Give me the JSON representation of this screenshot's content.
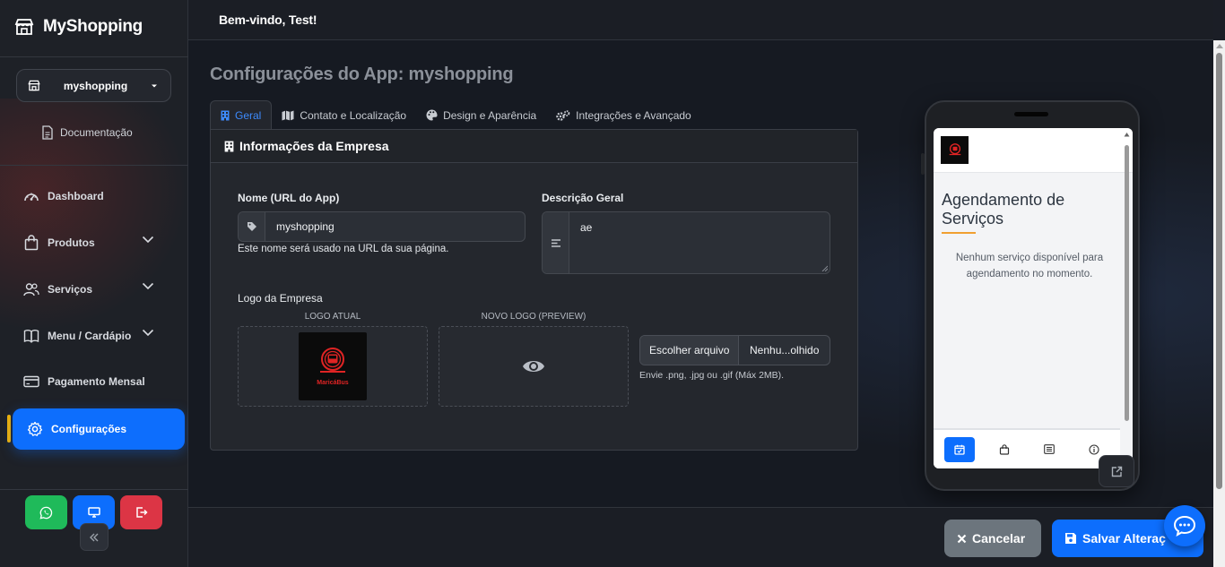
{
  "app": {
    "brand": "MyShopping"
  },
  "sidebar": {
    "store_selector": "myshopping",
    "doc_link": "Documentação",
    "items": [
      {
        "label": "Dashboard",
        "icon": "dashboard-gauge-icon",
        "has_submenu": false
      },
      {
        "label": "Produtos",
        "icon": "shopping-bag-icon",
        "has_submenu": true
      },
      {
        "label": "Serviços",
        "icon": "people-icon",
        "has_submenu": true
      },
      {
        "label": "Menu / Cardápio",
        "icon": "book-icon",
        "has_submenu": true
      },
      {
        "label": "Pagamento Mensal",
        "icon": "credit-card-icon",
        "has_submenu": false
      },
      {
        "label": "Configurações",
        "icon": "gear-icon",
        "has_submenu": false,
        "active": true
      }
    ],
    "footer_buttons": [
      {
        "icon": "whatsapp-icon",
        "color": "#1fba5a"
      },
      {
        "icon": "monitor-icon",
        "color": "#0d6efd"
      },
      {
        "icon": "logout-icon",
        "color": "#dc3545"
      }
    ]
  },
  "topbar": {
    "welcome": "Bem-vindo, Test!"
  },
  "page": {
    "title": "Configurações do App: myshopping",
    "tabs": [
      {
        "label": "Geral",
        "icon": "building-icon",
        "active": true
      },
      {
        "label": "Contato e Localização",
        "icon": "map-icon",
        "active": false
      },
      {
        "label": "Design e Aparência",
        "icon": "palette-icon",
        "active": false
      },
      {
        "label": "Integrações e Avançado",
        "icon": "gears-icon",
        "active": false
      }
    ],
    "card": {
      "title": "Informações da Empresa",
      "name_label": "Nome (URL do App)",
      "name_value": "myshopping",
      "name_help": "Este nome será usado na URL da sua página.",
      "desc_label": "Descrição Geral",
      "desc_value": "ae",
      "logo_label": "Logo da Empresa",
      "logo_current_caption": "LOGO ATUAL",
      "logo_preview_caption": "NOVO LOGO (PREVIEW)",
      "logo_text": "MaricáBus",
      "file_button": "Escolher arquivo",
      "file_name": "Nenhu...olhido",
      "file_help": "Envie .png, .jpg ou .gif (Máx 2MB)."
    }
  },
  "preview": {
    "title": "Agendamento de Serviços",
    "empty_text": "Nenhum serviço disponível para agendamento no momento.",
    "tabbar": [
      "calendar-check-icon",
      "shopping-bag-icon",
      "list-icon",
      "info-icon"
    ]
  },
  "footer": {
    "cancel_label": "Cancelar",
    "save_label": "Salvar Alteraç"
  },
  "colors": {
    "accent": "#0d6efd",
    "active_marker": "#f5b300",
    "cancel": "#6c757d"
  }
}
